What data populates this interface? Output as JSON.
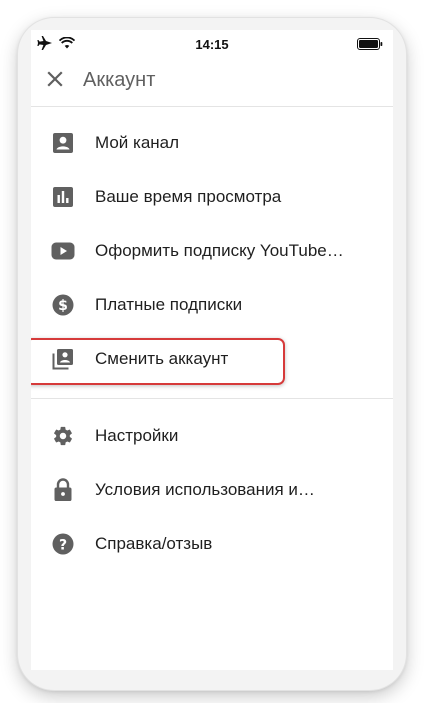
{
  "status_bar": {
    "time": "14:15",
    "icons": [
      "airplane-icon",
      "wifi-icon",
      "battery-icon"
    ]
  },
  "app_bar": {
    "title": "Аккаунт",
    "close_icon": "close-icon"
  },
  "menu": {
    "group1": [
      {
        "icon": "account-box-icon",
        "label": "Мой канал"
      },
      {
        "icon": "bar-chart-icon",
        "label": "Ваше время просмотра"
      },
      {
        "icon": "youtube-play-icon",
        "label": "Оформить подписку YouTube…"
      },
      {
        "icon": "dollar-circle-icon",
        "label": "Платные подписки"
      },
      {
        "icon": "switch-account-icon",
        "label": "Сменить аккаунт",
        "highlighted": true
      }
    ],
    "group2": [
      {
        "icon": "gear-icon",
        "label": "Настройки"
      },
      {
        "icon": "lock-icon",
        "label": "Условия использования и…"
      },
      {
        "icon": "help-icon",
        "label": "Справка/отзыв"
      }
    ]
  },
  "colors": {
    "icon": "#606060",
    "text": "#1f1f1f",
    "highlight": "#d63a3a"
  }
}
